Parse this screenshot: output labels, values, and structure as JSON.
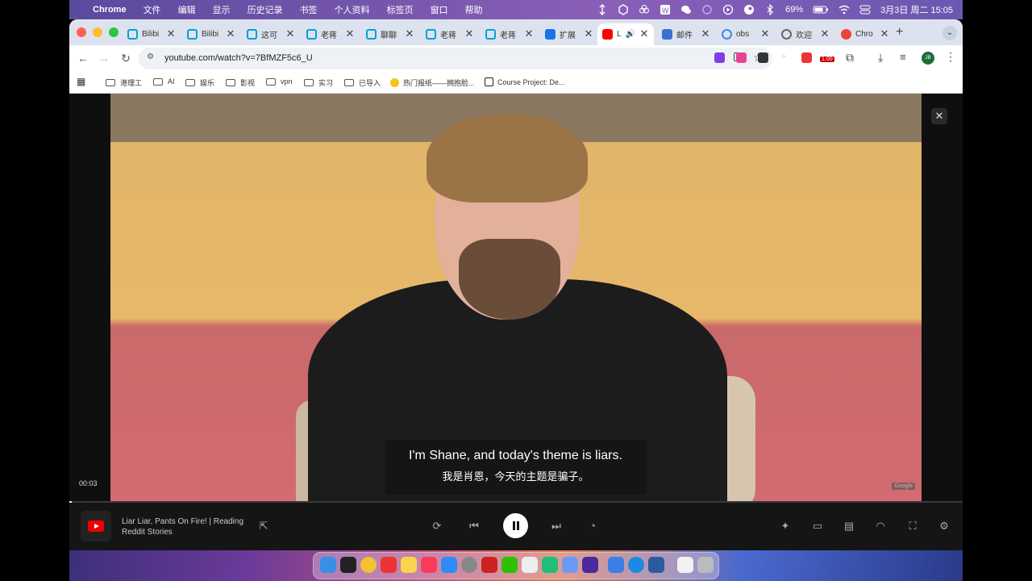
{
  "menubar": {
    "apple": "",
    "app": "Chrome",
    "items": [
      "文件",
      "编辑",
      "显示",
      "历史记录",
      "书签",
      "个人资料",
      "标签页",
      "窗口",
      "帮助"
    ],
    "battery": "69%",
    "datetime": "3月3日 周二  15:05"
  },
  "tabs": [
    {
      "label": "Bilibi",
      "icon_color": "#00a1d6"
    },
    {
      "label": "Bilibi",
      "icon_color": "#00a1d6"
    },
    {
      "label": "这可",
      "icon_color": "#00a1d6"
    },
    {
      "label": "老蒋",
      "icon_color": "#00a1d6"
    },
    {
      "label": "聊聊",
      "icon_color": "#00a1d6"
    },
    {
      "label": "老蒋",
      "icon_color": "#00a1d6"
    },
    {
      "label": "老蒋",
      "icon_color": "#00a1d6"
    },
    {
      "label": "扩展",
      "icon_color": "#1a73e8"
    },
    {
      "label": "L",
      "icon_color": "#ff0000"
    },
    {
      "label": "邮件",
      "icon_color": "#3b6fd0"
    },
    {
      "label": "obs",
      "icon_color": "#4285f4"
    },
    {
      "label": "欢迎",
      "icon_color": "#666666"
    },
    {
      "label": "Chro",
      "icon_color": "#e8443a"
    }
  ],
  "new_tab_symbol": "+",
  "tab_close": "✕",
  "toolbar": {
    "back": "←",
    "forward": "→",
    "reload": "↻",
    "url": "youtube.com/watch?v=7BfMZF5c6_U",
    "star": "☆",
    "ext_badge": "1.00",
    "profile_initial": "JB",
    "menu": "⋮"
  },
  "bookmarks": [
    {
      "label": "港理工",
      "type": "folder"
    },
    {
      "label": "AI",
      "type": "folder"
    },
    {
      "label": "娱乐",
      "type": "folder"
    },
    {
      "label": "影视",
      "type": "folder"
    },
    {
      "label": "vpn",
      "type": "folder"
    },
    {
      "label": "实习",
      "type": "folder"
    },
    {
      "label": "已导入",
      "type": "folder"
    },
    {
      "label": "热门报纸——拥抱脸...",
      "type": "link"
    },
    {
      "label": "Course Project: De...",
      "type": "link"
    }
  ],
  "player": {
    "subtitle_en": "I'm Shane, and today's theme is liars.",
    "subtitle_zh": "我是肖恩，今天的主题是骗子。",
    "google_badge": "Google",
    "time": "00:03",
    "progress": 0.003,
    "video_title": "Liar Liar, Pants On Fire! | Reading Reddit Stories",
    "close": "✕"
  },
  "colors": {
    "accent_red": "#ff0000",
    "menubar": "#7b5fb8",
    "tabstrip": "#dde3ee"
  }
}
